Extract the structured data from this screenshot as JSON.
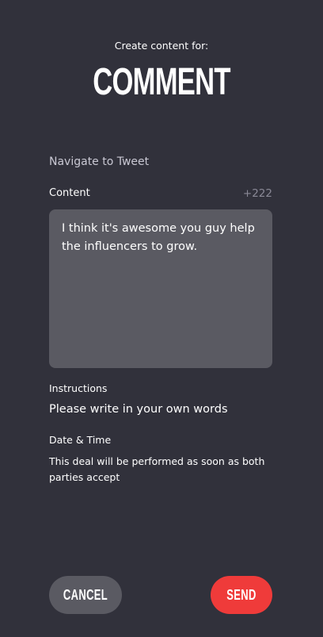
{
  "header": {
    "subtitle": "Create content for:",
    "title": "COMMENT"
  },
  "navigate_link": "Navigate to Tweet",
  "content": {
    "label": "Content",
    "char_count": "+222",
    "text": "I think it's awesome you guy help the influencers to grow."
  },
  "instructions": {
    "label": "Instructions",
    "text": "Please write in your own words"
  },
  "date_time": {
    "label": "Date & Time",
    "text": "This deal will be performed as soon as both parties accept"
  },
  "buttons": {
    "cancel": "CANCEL",
    "send": "SEND"
  },
  "colors": {
    "background": "#31313b",
    "field": "#5a5a62",
    "accent": "#ef3b3a"
  }
}
